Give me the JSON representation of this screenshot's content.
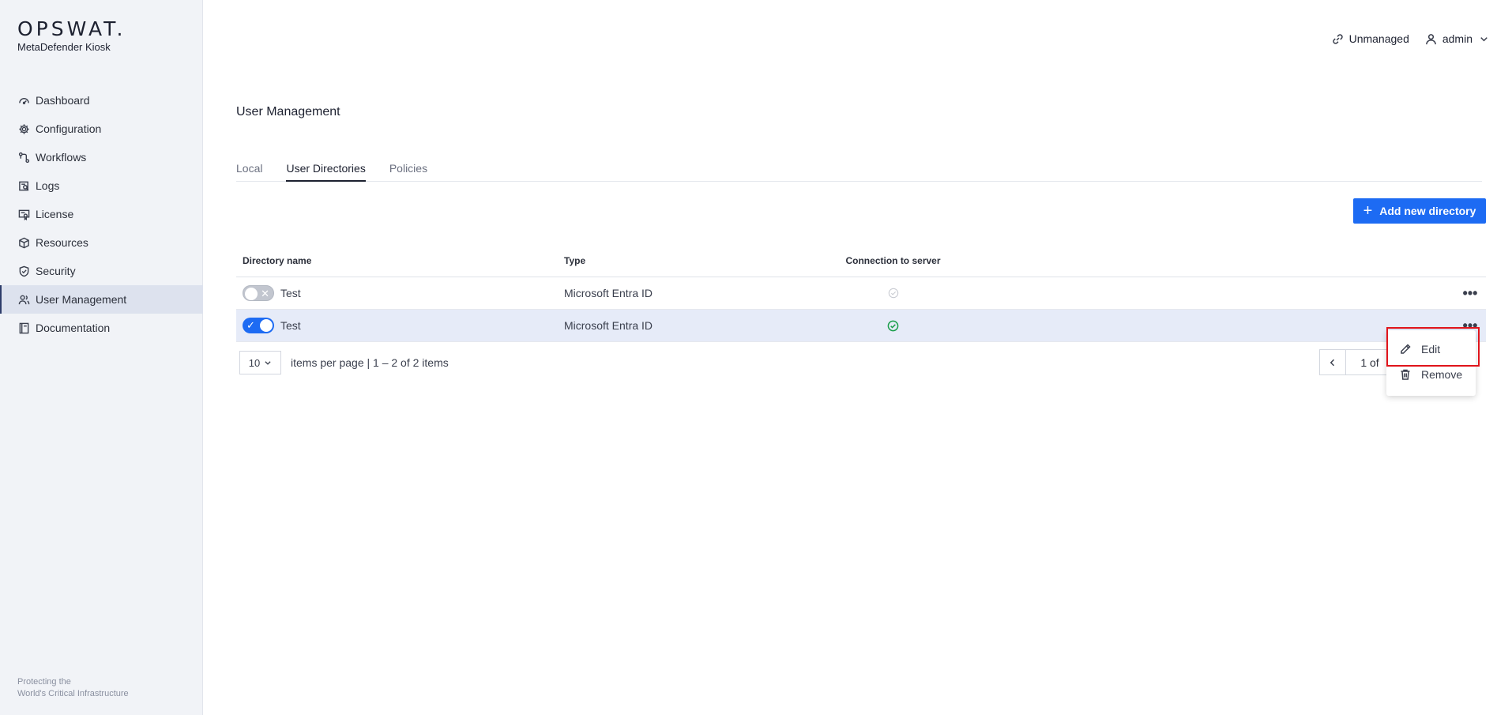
{
  "brand": {
    "logo": "OPSWAT.",
    "product": "MetaDefender Kiosk"
  },
  "sidebar": {
    "items": [
      {
        "label": "Dashboard",
        "icon": "dashboard-icon"
      },
      {
        "label": "Configuration",
        "icon": "gear-icon"
      },
      {
        "label": "Workflows",
        "icon": "workflow-icon"
      },
      {
        "label": "Logs",
        "icon": "logs-icon"
      },
      {
        "label": "License",
        "icon": "license-icon"
      },
      {
        "label": "Resources",
        "icon": "box-icon"
      },
      {
        "label": "Security",
        "icon": "shield-icon"
      },
      {
        "label": "User Management",
        "icon": "users-icon",
        "active": true
      },
      {
        "label": "Documentation",
        "icon": "book-icon"
      }
    ],
    "footer_line1": "Protecting the",
    "footer_line2": "World's Critical Infrastructure"
  },
  "header": {
    "status": "Unmanaged",
    "user": "admin"
  },
  "page": {
    "title": "User Management"
  },
  "tabs": [
    {
      "label": "Local"
    },
    {
      "label": "User Directories",
      "active": true
    },
    {
      "label": "Policies"
    }
  ],
  "toolbar": {
    "add_label": "Add new directory"
  },
  "table": {
    "headers": {
      "name": "Directory name",
      "type": "Type",
      "connection": "Connection to server"
    },
    "rows": [
      {
        "enabled": false,
        "name": "Test",
        "type": "Microsoft Entra ID",
        "connected": false
      },
      {
        "enabled": true,
        "name": "Test",
        "type": "Microsoft Entra ID",
        "connected": true
      }
    ]
  },
  "pagination": {
    "page_size": "10",
    "summary": "items per page | 1 – 2 of 2 items",
    "page_label": "1 of"
  },
  "context_menu": {
    "edit": "Edit",
    "remove": "Remove"
  },
  "colors": {
    "primary": "#1d6bf3",
    "success": "#1a9e4a",
    "highlight": "#e0141b"
  }
}
